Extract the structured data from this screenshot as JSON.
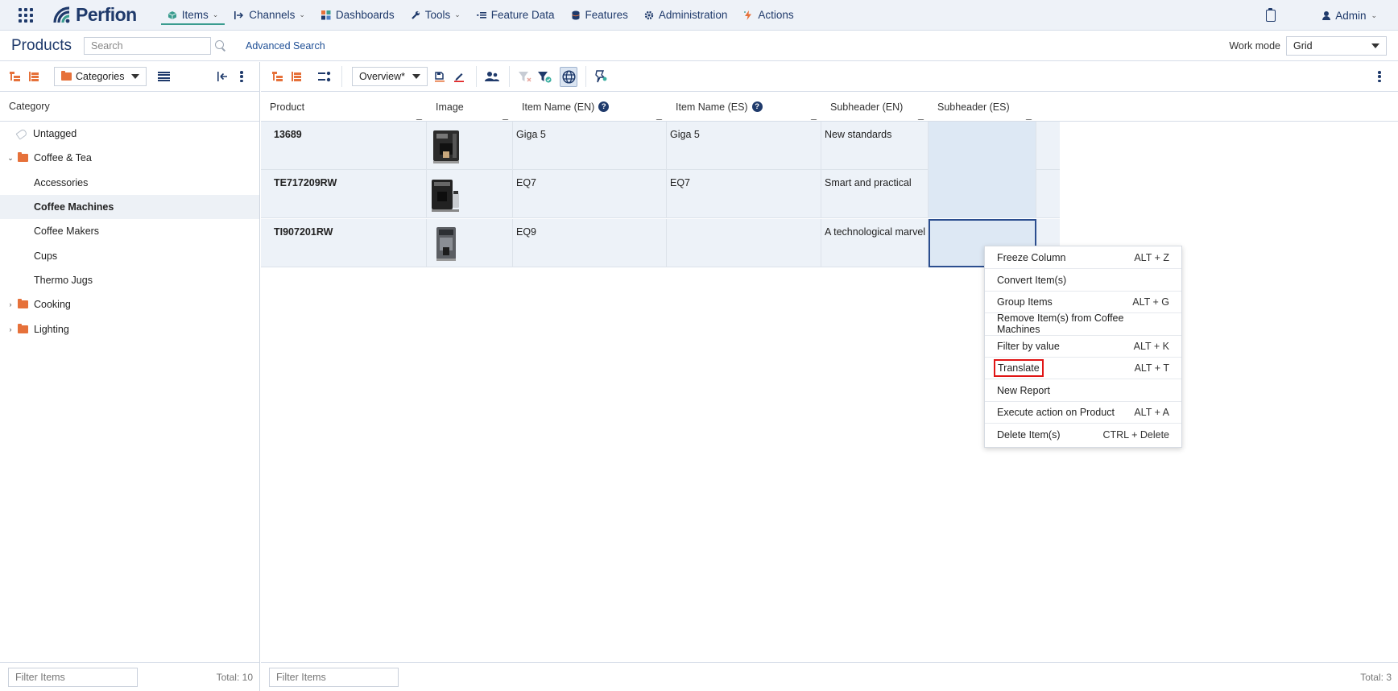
{
  "topnav": {
    "brand": "Perfion",
    "items": [
      {
        "label": "Items",
        "icon": "cube-icon",
        "active": true,
        "dropdown": true
      },
      {
        "label": "Channels",
        "icon": "channel-icon",
        "active": false,
        "dropdown": true
      },
      {
        "label": "Dashboards",
        "icon": "dashboard-icon",
        "active": false,
        "dropdown": false
      },
      {
        "label": "Tools",
        "icon": "wrench-icon",
        "active": false,
        "dropdown": true
      },
      {
        "label": "Feature Data",
        "icon": "list-icon",
        "active": false,
        "dropdown": false
      },
      {
        "label": "Features",
        "icon": "database-icon",
        "active": false,
        "dropdown": false
      },
      {
        "label": "Administration",
        "icon": "gear-icon",
        "active": false,
        "dropdown": false
      },
      {
        "label": "Actions",
        "icon": "lightning-icon",
        "active": false,
        "dropdown": false
      }
    ],
    "user": "Admin"
  },
  "header": {
    "title": "Products",
    "search_placeholder": "Search",
    "advanced_search": "Advanced Search",
    "workmode_label": "Work mode",
    "workmode_value": "Grid"
  },
  "left_toolbar": {
    "category_select": "Categories"
  },
  "right_toolbar": {
    "view_select": "Overview*"
  },
  "tree": {
    "header": "Category",
    "items": [
      {
        "label": "Untagged",
        "level": 0,
        "type": "tag",
        "arrow": ""
      },
      {
        "label": "Coffee & Tea",
        "level": 0,
        "type": "folder",
        "arrow": "⌄"
      },
      {
        "label": "Accessories",
        "level": 1,
        "type": "leaf",
        "arrow": ""
      },
      {
        "label": "Coffee Machines",
        "level": 1,
        "type": "leaf",
        "arrow": "",
        "selected": true
      },
      {
        "label": "Coffee Makers",
        "level": 1,
        "type": "leaf",
        "arrow": ""
      },
      {
        "label": "Cups",
        "level": 1,
        "type": "leaf",
        "arrow": ""
      },
      {
        "label": "Thermo Jugs",
        "level": 1,
        "type": "leaf",
        "arrow": ""
      },
      {
        "label": "Cooking",
        "level": 0,
        "type": "folder",
        "arrow": "›"
      },
      {
        "label": "Lighting",
        "level": 0,
        "type": "folder",
        "arrow": "›"
      }
    ],
    "filter_placeholder": "Filter Items",
    "total": "Total: 10"
  },
  "grid": {
    "columns": [
      "Product",
      "Image",
      "Item Name (EN)",
      "Item Name (ES)",
      "Subheader (EN)",
      "Subheader (ES)"
    ],
    "rows": [
      {
        "product": "13689",
        "name_en": "Giga 5",
        "name_es": "Giga 5",
        "sub_en": "New standards",
        "sub_es": ""
      },
      {
        "product": "TE717209RW",
        "name_en": "EQ7",
        "name_es": "EQ7",
        "sub_en": "Smart and practical",
        "sub_es": ""
      },
      {
        "product": "TI907201RW",
        "name_en": "EQ9",
        "name_es": "",
        "sub_en": "A technological marvel",
        "sub_es": ""
      }
    ],
    "filter_placeholder": "Filter Items",
    "total": "Total: 3"
  },
  "context_menu": [
    {
      "label": "Freeze Column",
      "shortcut": "ALT + Z"
    },
    {
      "label": "Convert Item(s)",
      "shortcut": ""
    },
    {
      "label": "Group Items",
      "shortcut": "ALT + G"
    },
    {
      "label": "Remove Item(s) from Coffee Machines",
      "shortcut": ""
    },
    {
      "label": "Filter by value",
      "shortcut": "ALT + K"
    },
    {
      "label": "Translate",
      "shortcut": "ALT + T",
      "highlight": true
    },
    {
      "label": "New Report",
      "shortcut": ""
    },
    {
      "label": "Execute action on Product",
      "shortcut": "ALT + A"
    },
    {
      "label": "Delete Item(s)",
      "shortcut": "CTRL + Delete"
    }
  ],
  "colors": {
    "brand_navy": "#1f3a6b",
    "accent_orange": "#e6713a",
    "active_underline": "#3a9c8f",
    "highlight_red": "#e01515"
  }
}
